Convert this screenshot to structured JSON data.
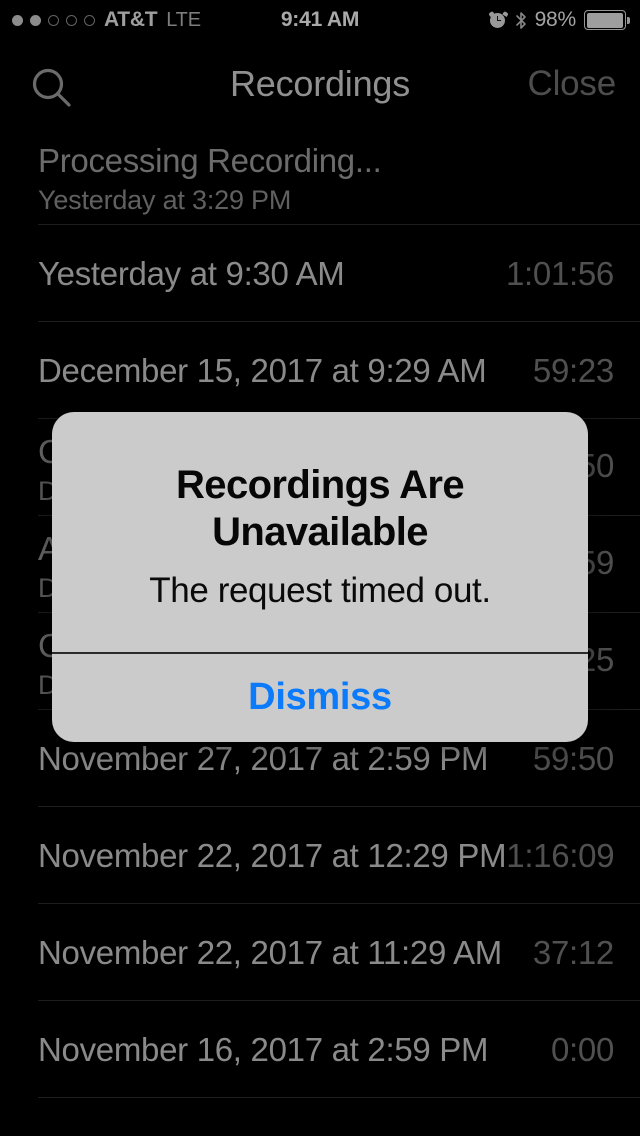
{
  "status_bar": {
    "signal_dots_filled": 2,
    "signal_dots_total": 5,
    "carrier": "AT&T",
    "network": "LTE",
    "time": "9:41 AM",
    "alarm_icon": "alarm-clock-icon",
    "bluetooth_icon": "bluetooth-icon",
    "battery_percent": "98%",
    "battery_level": 98
  },
  "nav_bar": {
    "search_icon": "search-icon",
    "title": "Recordings",
    "close_label": "Close"
  },
  "list": {
    "rows": [
      {
        "title": "Processing Recording...",
        "subtitle": "Yesterday at 3:29 PM",
        "duration": "",
        "processing": true
      },
      {
        "title": "Yesterday at 9:30 AM",
        "subtitle": "",
        "duration": "1:01:56",
        "processing": false
      },
      {
        "title": "December 15, 2017 at 9:29 AM",
        "subtitle": "",
        "duration": "59:23",
        "processing": false
      },
      {
        "title": "C",
        "subtitle": "D",
        "duration": "50",
        "processing": false
      },
      {
        "title": "A",
        "subtitle": "D",
        "duration": "59",
        "processing": false
      },
      {
        "title": "C",
        "subtitle": "D",
        "duration": "25",
        "processing": false
      },
      {
        "title": "November 27, 2017 at 2:59 PM",
        "subtitle": "",
        "duration": "59:50",
        "processing": false
      },
      {
        "title": "November 22, 2017 at 12:29 PM",
        "subtitle": "",
        "duration": "1:16:09",
        "processing": false
      },
      {
        "title": "November 22, 2017 at 11:29 AM",
        "subtitle": "",
        "duration": "37:12",
        "processing": false
      },
      {
        "title": "November 16, 2017 at 2:59 PM",
        "subtitle": "",
        "duration": "0:00",
        "processing": false
      }
    ]
  },
  "alert": {
    "title": "Recordings Are Unavailable",
    "message": "The request timed out.",
    "dismiss_label": "Dismiss",
    "accent_color": "#0b7bfb",
    "panel_color": "#cbcbcb"
  }
}
